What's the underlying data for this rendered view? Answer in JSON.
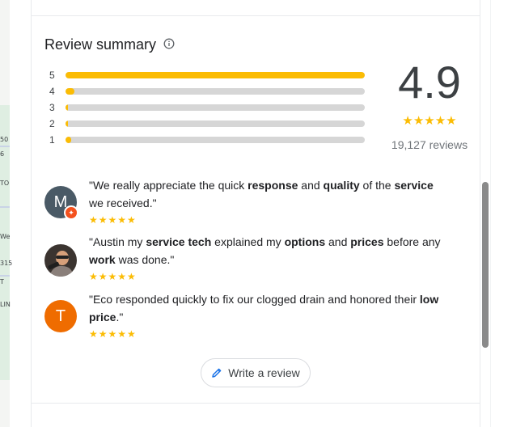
{
  "map": {
    "labels": [
      "50",
      "6",
      "TO",
      "We",
      "315",
      "T",
      "LIN"
    ]
  },
  "summary": {
    "title": "Review summary",
    "rating": "4.9",
    "stars": "★★★★★",
    "count_text": "19,127 reviews",
    "distribution": [
      {
        "label": "5",
        "fraction": 1.0
      },
      {
        "label": "4",
        "fraction": 0.03
      },
      {
        "label": "3",
        "fraction": 0.005
      },
      {
        "label": "2",
        "fraction": 0.005
      },
      {
        "label": "1",
        "fraction": 0.02
      }
    ]
  },
  "snippets": [
    {
      "avatar_letter": "M",
      "avatar_color": "#4a5a66",
      "stars": "★★★★★",
      "parts": [
        {
          "t": "\"We really appreciate the quick ",
          "b": false
        },
        {
          "t": "response",
          "b": true
        },
        {
          "t": " and ",
          "b": false
        },
        {
          "t": "quality",
          "b": true
        },
        {
          "t": " of the ",
          "b": false
        },
        {
          "t": "service",
          "b": true
        },
        {
          "t": " we received.\"",
          "b": false
        }
      ]
    },
    {
      "avatar_letter": "",
      "avatar_color": "#5a4a3a",
      "stars": "★★★★★",
      "parts": [
        {
          "t": "\"Austin my ",
          "b": false
        },
        {
          "t": "service tech",
          "b": true
        },
        {
          "t": " explained my ",
          "b": false
        },
        {
          "t": "options",
          "b": true
        },
        {
          "t": " and ",
          "b": false
        },
        {
          "t": "prices",
          "b": true
        },
        {
          "t": " before any ",
          "b": false
        },
        {
          "t": "work",
          "b": true
        },
        {
          "t": " was done.\"",
          "b": false
        }
      ]
    },
    {
      "avatar_letter": "T",
      "avatar_color": "#ef6c00",
      "stars": "★★★★★",
      "parts": [
        {
          "t": "\"Eco responded quickly to fix our clogged drain and honored their ",
          "b": false
        },
        {
          "t": "low price",
          "b": true
        },
        {
          "t": ".\"",
          "b": false
        }
      ]
    }
  ],
  "write_review": {
    "label": "Write a review"
  },
  "colors": {
    "star": "#fbbc04",
    "accent": "#1a73e8"
  }
}
